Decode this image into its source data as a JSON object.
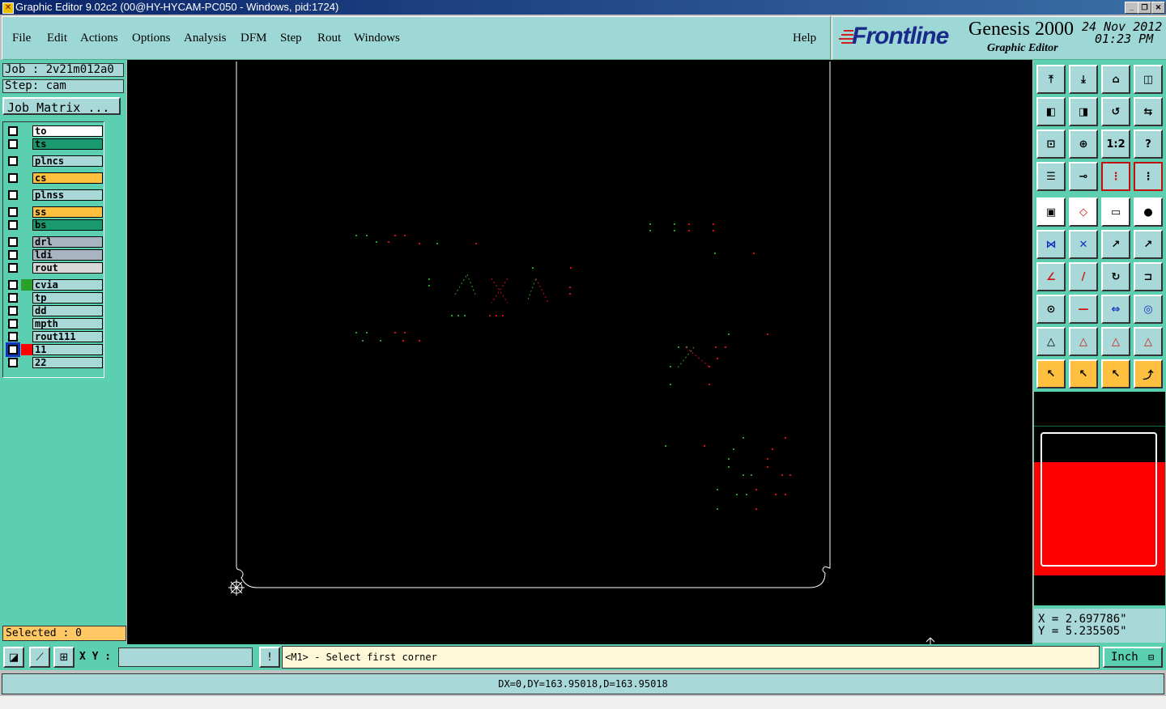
{
  "window": {
    "title": "Graphic Editor 9.02c2 (00@HY-HYCAM-PC050 - Windows, pid:1724)"
  },
  "menu": {
    "items": [
      "File",
      "Edit",
      "Actions",
      "Options",
      "Analysis",
      "DFM",
      "Step",
      "Rout",
      "Windows"
    ],
    "help": "Help"
  },
  "brand": {
    "logo": "Frontline",
    "product": "Genesis 2000",
    "subtitle": "Graphic Editor",
    "date": "24 Nov 2012",
    "time": "01:23 PM"
  },
  "job": {
    "job_label": "Job : 2v21m012a0",
    "step_label": "Step: cam",
    "matrix_button": "Job Matrix ..."
  },
  "layers": [
    {
      "name": "to",
      "color": "#ffffff",
      "swatch": ""
    },
    {
      "name": "ts",
      "color": "#1a9a6e",
      "swatch": ""
    },
    {
      "name": "plncs",
      "color": "#a8d8d8",
      "swatch": ""
    },
    {
      "name": "cs",
      "color": "#ffc040",
      "swatch": ""
    },
    {
      "name": "plnss",
      "color": "#a8d8d8",
      "swatch": ""
    },
    {
      "name": "ss",
      "color": "#ffc040",
      "swatch": ""
    },
    {
      "name": "bs",
      "color": "#1a9a6e",
      "swatch": ""
    },
    {
      "name": "drl",
      "color": "#a8b4c0",
      "swatch": ""
    },
    {
      "name": "ldi",
      "color": "#a8b4c0",
      "swatch": ""
    },
    {
      "name": "rout",
      "color": "#d8d8d8",
      "swatch": ""
    },
    {
      "name": "cvia",
      "color": "#a8d8d8",
      "swatch": "#2aa02a"
    },
    {
      "name": "tp",
      "color": "#a8d8d8",
      "swatch": ""
    },
    {
      "name": "dd",
      "color": "#a8d8d8",
      "swatch": ""
    },
    {
      "name": "mpth",
      "color": "#a8d8d8",
      "swatch": ""
    },
    {
      "name": "rout111",
      "color": "#a8d8d8",
      "swatch": ""
    },
    {
      "name": "11",
      "color": "#a8d8d8",
      "swatch": "#ff0000",
      "checked": true
    },
    {
      "name": "22",
      "color": "#a8d8d8",
      "swatch": ""
    }
  ],
  "status": {
    "selected": "Selected : 0",
    "xy_label": "X Y :",
    "xy_value": "",
    "prompt": "<M1> - Select first corner",
    "units": "Inch",
    "measure": "DX=0,DY=163.95018,D=163.95018"
  },
  "coords": {
    "x": "X = 2.697786\"",
    "y": "Y = 5.235505\""
  },
  "colors": {
    "panel": "#5ccfb0",
    "field": "#a8d8d8",
    "accent_red": "#ff0000",
    "green": "#2aa02a"
  }
}
